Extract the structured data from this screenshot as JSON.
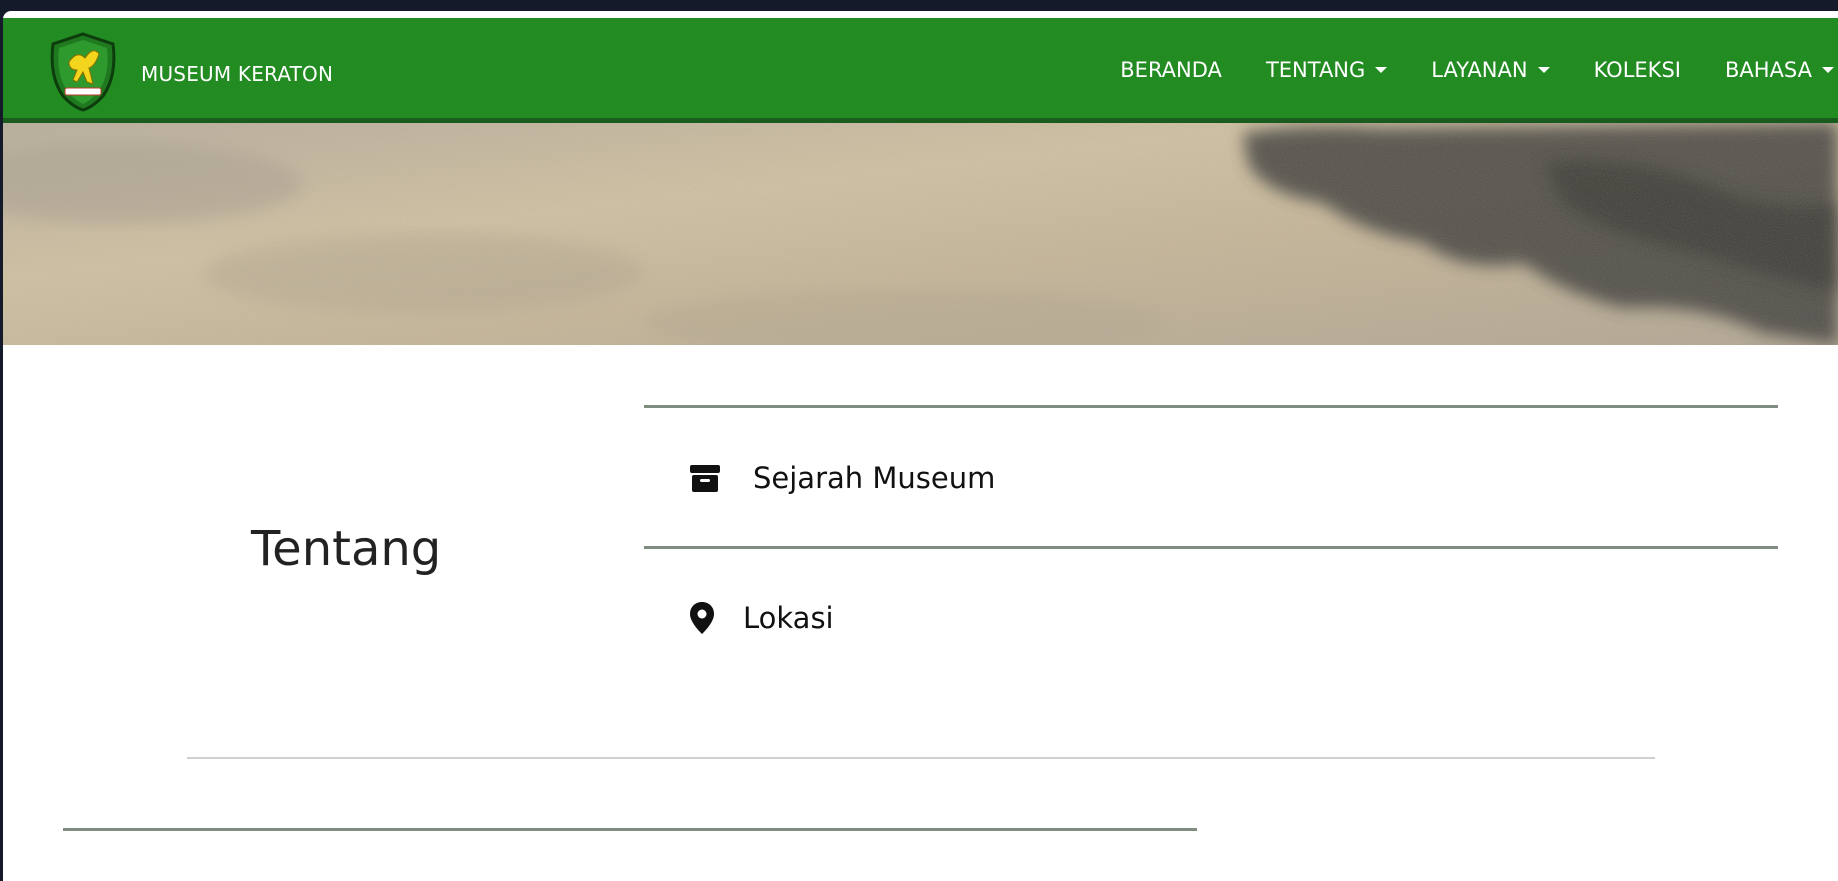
{
  "brand": {
    "name": "MUSEUM KERATON"
  },
  "nav": {
    "items": [
      {
        "label": "BERANDA",
        "dropdown": false
      },
      {
        "label": "TENTANG",
        "dropdown": true
      },
      {
        "label": "LAYANAN",
        "dropdown": true
      },
      {
        "label": "KOLEKSI",
        "dropdown": false
      },
      {
        "label": "BAHASA",
        "dropdown": true
      }
    ]
  },
  "about": {
    "title": "Tentang",
    "links": [
      {
        "label": "Sejarah Museum",
        "icon": "archive-box-icon"
      },
      {
        "label": "Lokasi",
        "icon": "map-pin-icon"
      }
    ]
  },
  "colors": {
    "navbar": "#228b22",
    "navbar_shadow": "#1a5c1d",
    "divider": "#7f8c7f"
  }
}
